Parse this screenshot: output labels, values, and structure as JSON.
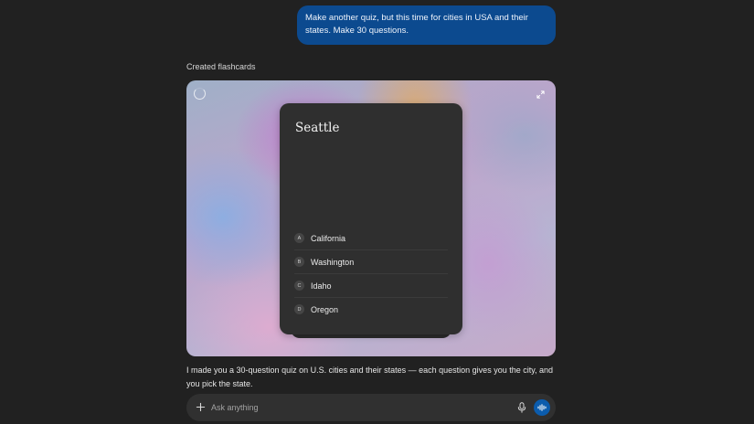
{
  "conversation": {
    "user_message": "Make another quiz, but this time for cities in USA and their states. Make 30 questions.",
    "tool_status": "Created flashcards",
    "assistant_message": "I made you a 30-question quiz on U.S. cities and their states — each question gives you the city, and you pick the state."
  },
  "flashcards": {
    "question": "Seattle",
    "options": [
      {
        "letter": "A",
        "label": "California"
      },
      {
        "letter": "B",
        "label": "Washington"
      },
      {
        "letter": "C",
        "label": "Idaho"
      },
      {
        "letter": "D",
        "label": "Oregon"
      }
    ],
    "icons": {
      "loading": "spinner-icon",
      "expand": "expand-icon"
    }
  },
  "composer": {
    "placeholder": "Ask anything",
    "value": "",
    "icons": {
      "attach": "plus-icon",
      "dictate": "mic-icon",
      "voice": "voice-mode-icon"
    }
  },
  "colors": {
    "background": "#212121",
    "user_bubble": "#0c4a8f",
    "card": "#2f2f2f",
    "accent": "#0b5cad"
  }
}
